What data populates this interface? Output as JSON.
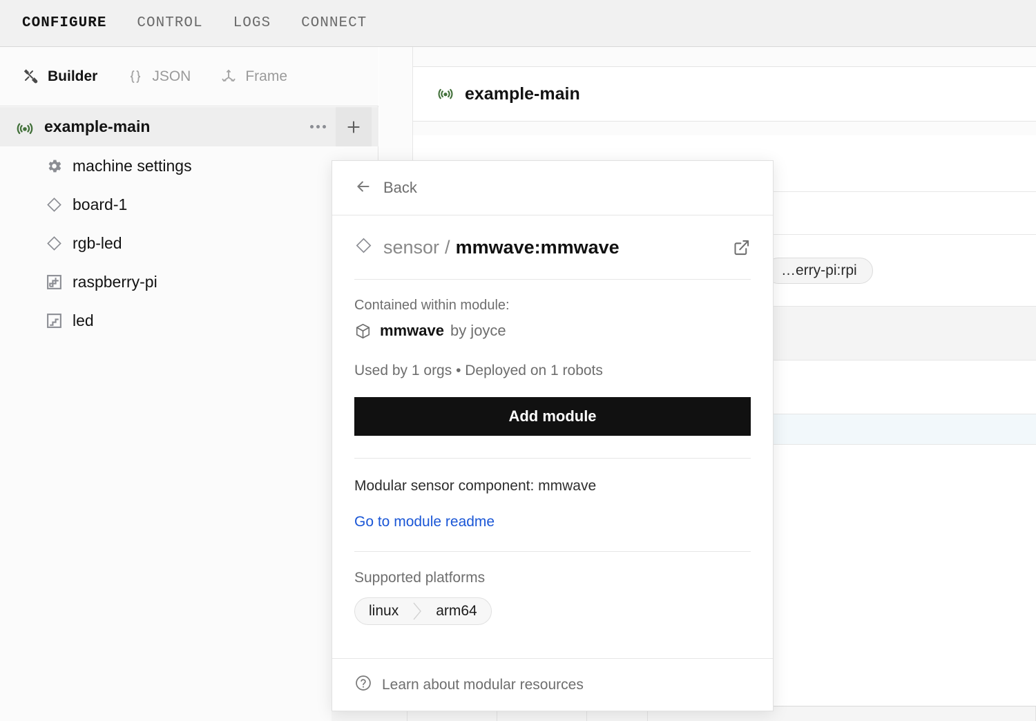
{
  "topnav": {
    "items": [
      {
        "label": "CONFIGURE",
        "active": true
      },
      {
        "label": "CONTROL",
        "active": false
      },
      {
        "label": "LOGS",
        "active": false
      },
      {
        "label": "CONNECT",
        "active": false
      }
    ]
  },
  "modebar": {
    "items": [
      {
        "label": "Builder",
        "icon": "tools-icon",
        "active": true
      },
      {
        "label": "JSON",
        "icon": "braces-icon",
        "active": false
      },
      {
        "label": "Frame",
        "icon": "axes-icon",
        "active": false
      }
    ]
  },
  "sidebar": {
    "root": {
      "label": "example-main",
      "icon": "signal-icon",
      "more_label": "…",
      "add_label": "+"
    },
    "items": [
      {
        "label": "machine settings",
        "icon": "gear-icon"
      },
      {
        "label": "board-1",
        "icon": "diamond-icon"
      },
      {
        "label": "rgb-led",
        "icon": "diamond-icon"
      },
      {
        "label": "raspberry-pi",
        "icon": "steps-icon"
      },
      {
        "label": "led",
        "icon": "steps-icon"
      }
    ]
  },
  "main": {
    "card_title": "example-main",
    "card_icon": "signal-icon",
    "pill_label": "…erry-pi:rpi"
  },
  "popup": {
    "back_label": "Back",
    "back_icon": "arrow-left-icon",
    "resource_type": "sensor",
    "separator": "/",
    "resource_name": "mmwave:mmwave",
    "type_icon": "diamond-icon",
    "external_icon": "external-link-icon",
    "contained_label": "Contained within module:",
    "module_icon": "package-icon",
    "module_name": "mmwave",
    "module_by": "by joyce",
    "usage": "Used by 1 orgs  •  Deployed on 1 robots",
    "add_button": "Add module",
    "description": "Modular sensor component: mmwave",
    "readme_link": "Go to module readme",
    "platforms_label": "Supported platforms",
    "platforms": [
      "linux",
      "arm64"
    ],
    "footer_label": "Learn about modular resources",
    "footer_icon": "help-circle-icon"
  },
  "colors": {
    "accent_green": "#43713b",
    "link_blue": "#1a56d6",
    "button_black": "#111111",
    "nav_bg": "#f1f1f1"
  }
}
